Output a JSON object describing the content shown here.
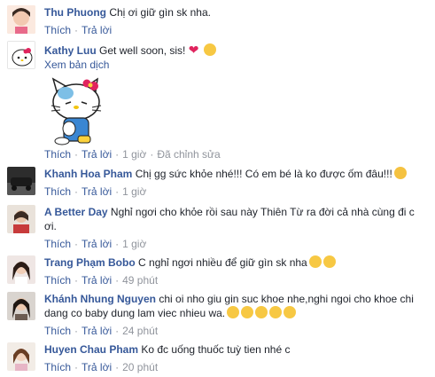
{
  "comments": [
    {
      "name": "Thu Phuong",
      "text": "Chị ơi giữ gìn sk nha.",
      "like": "Thích",
      "reply": "Trả lời"
    },
    {
      "name": "Kathy Luu",
      "text": "Get well soon, sis!",
      "see_translation": "Xem bản dịch",
      "like": "Thích",
      "reply": "Trả lời",
      "time": "1 giờ",
      "edited": "Đã chỉnh sửa"
    },
    {
      "name": "Khanh Hoa Pham",
      "text": "Chị gg sức khỏe nhé!!! Có em bé là ko được ốm đâu!!!",
      "like": "Thích",
      "reply": "Trả lời",
      "time": "1 giờ"
    },
    {
      "name": "A Better Day",
      "text": "Nghỉ ngơi cho khỏe rồi sau này Thiên Từ ra đời cả nhà cùng đi c ơi.",
      "like": "Thích",
      "reply": "Trả lời",
      "time": "1 giờ"
    },
    {
      "name": "Trang Phạm Bobo",
      "text": "C nghỉ ngơi nhiều để giữ gìn sk nha",
      "like": "Thích",
      "reply": "Trả lời",
      "time": "49 phút"
    },
    {
      "name": "Khánh Nhung Nguyen",
      "text": "chi oi nho giu gin suc khoe nhe,nghi ngoi cho khoe chi dang co baby dung lam viec nhieu wa.",
      "like": "Thích",
      "reply": "Trả lời",
      "time": "24 phút"
    },
    {
      "name": "Huyen Chau Pham",
      "text": "Ko đc uống thuốc tuỳ tien nhé c",
      "like": "Thích",
      "reply": "Trả lời",
      "time": "20 phút"
    }
  ],
  "colors": {
    "name": "#365899",
    "text": "#1d2129",
    "muted": "#90949c"
  }
}
